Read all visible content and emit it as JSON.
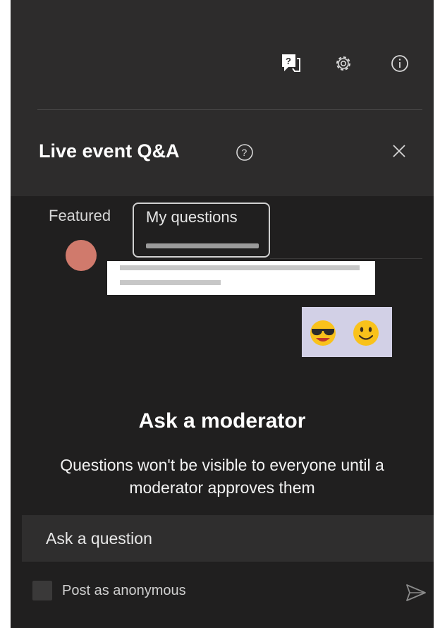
{
  "panel": {
    "title": "Live event Q&A",
    "icons": [
      "qa-icon",
      "gear-icon",
      "info-icon",
      "help-icon",
      "close-icon"
    ]
  },
  "tabs": [
    {
      "label": "Featured",
      "selected": false
    },
    {
      "label": "My questions",
      "selected": true
    }
  ],
  "empty_state": {
    "heading": "Ask a moderator",
    "description": "Questions won't be visible to everyone until a moderator approves them"
  },
  "composer": {
    "placeholder": "Ask a question",
    "anonymous_label": "Post as anonymous",
    "anonymous_checked": false
  },
  "colors": {
    "panel_background": "#201f1f",
    "header_background": "#2d2c2c",
    "input_background": "#2f2e2e",
    "text_primary": "#ffffff"
  }
}
